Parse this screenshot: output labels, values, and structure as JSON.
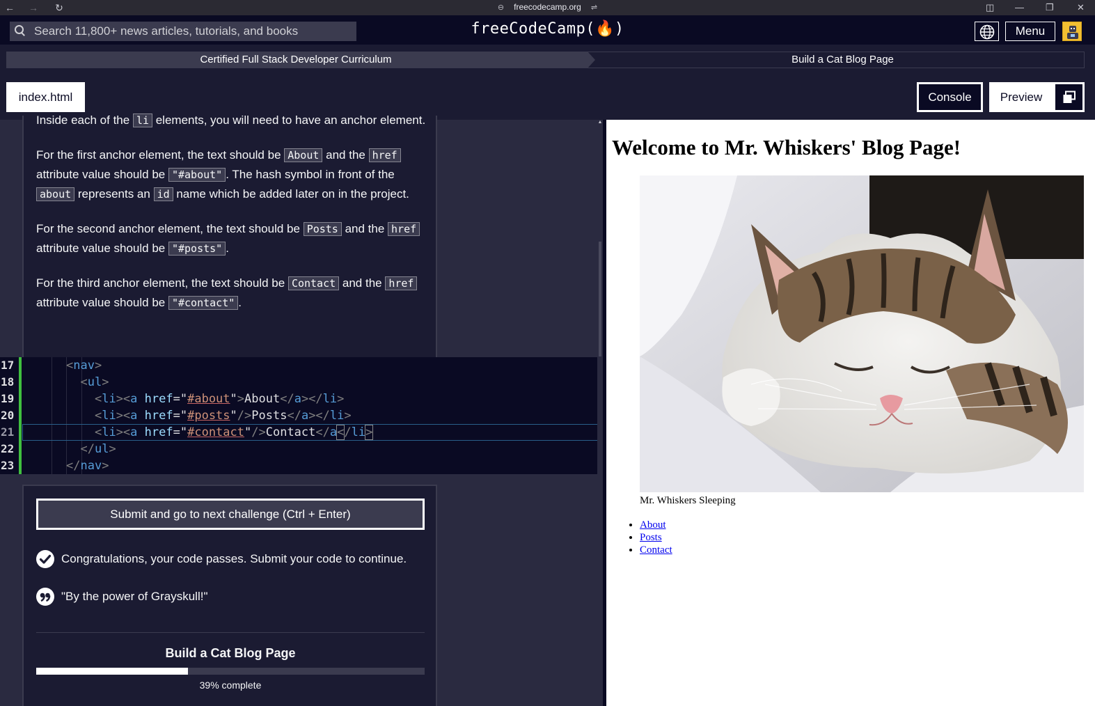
{
  "browser": {
    "url": "freecodecamp.org"
  },
  "nav": {
    "search_placeholder": "Search 11,800+ news articles, tutorials, and books",
    "logo": "freeCodeCamp(🔥)",
    "menu_label": "Menu"
  },
  "breadcrumb": {
    "curriculum": "Certified Full Stack Developer Curriculum",
    "project": "Build a Cat Blog Page"
  },
  "toolbar": {
    "file_tab": "index.html",
    "console_label": "Console",
    "preview_label": "Preview"
  },
  "instructions": {
    "p1": {
      "t1": "Inside each of the ",
      "c1": "li",
      "t2": " elements, you will need to have an anchor element."
    },
    "p2": {
      "t1": "For the first anchor element, the text should be ",
      "c1": "About",
      "t2": " and the ",
      "c2": "href",
      "t3": " attribute value should be ",
      "c3": "\"#about\"",
      "t4": ". The hash symbol in front of the ",
      "c4": "about",
      "t5": " represents an ",
      "c5": "id",
      "t6": " name which be added later on in the project."
    },
    "p3": {
      "t1": "For the second anchor element, the text should be ",
      "c1": "Posts",
      "t2": " and the ",
      "c2": "href",
      "t3": " attribute value should be ",
      "c3": "\"#posts\"",
      "t4": "."
    },
    "p4": {
      "t1": "For the third anchor element, the text should be ",
      "c1": "Contact",
      "t2": " and the ",
      "c2": "href",
      "t3": " attribute value should be ",
      "c3": "\"#contact\"",
      "t4": "."
    }
  },
  "editor": {
    "line_numbers": [
      "17",
      "18",
      "19",
      "20",
      "21",
      "22",
      "23"
    ],
    "lines": [
      {
        "indent": "",
        "parts": [
          [
            "brk",
            "<"
          ],
          [
            "tag",
            "nav"
          ],
          [
            "brk",
            ">"
          ]
        ]
      },
      {
        "indent": "  ",
        "parts": [
          [
            "brk",
            "<"
          ],
          [
            "tag",
            "ul"
          ],
          [
            "brk",
            ">"
          ]
        ]
      },
      {
        "indent": "    ",
        "parts": [
          [
            "brk",
            "<"
          ],
          [
            "tag",
            "li"
          ],
          [
            "brk",
            "><"
          ],
          [
            "tag",
            "a"
          ],
          [
            "txt",
            " "
          ],
          [
            "attr",
            "href"
          ],
          [
            "txt",
            "=\""
          ],
          [
            "str",
            "#about"
          ],
          [
            "txt",
            "\""
          ],
          [
            "brk",
            ">"
          ],
          [
            "txt",
            "About"
          ],
          [
            "brk",
            "</"
          ],
          [
            "tag",
            "a"
          ],
          [
            "brk",
            "></"
          ],
          [
            "tag",
            "li"
          ],
          [
            "brk",
            ">"
          ]
        ]
      },
      {
        "indent": "    ",
        "parts": [
          [
            "brk",
            "<"
          ],
          [
            "tag",
            "li"
          ],
          [
            "brk",
            "><"
          ],
          [
            "tag",
            "a"
          ],
          [
            "txt",
            " "
          ],
          [
            "attr",
            "href"
          ],
          [
            "txt",
            "=\""
          ],
          [
            "str",
            "#posts"
          ],
          [
            "txt",
            "\""
          ],
          [
            "brk",
            "/>"
          ],
          [
            "txt",
            "Posts"
          ],
          [
            "brk",
            "</"
          ],
          [
            "tag",
            "a"
          ],
          [
            "brk",
            "></"
          ],
          [
            "tag",
            "li"
          ],
          [
            "brk",
            ">"
          ]
        ]
      },
      {
        "indent": "    ",
        "parts": [
          [
            "brk",
            "<"
          ],
          [
            "tag",
            "li"
          ],
          [
            "brk",
            "><"
          ],
          [
            "tag",
            "a"
          ],
          [
            "txt",
            " "
          ],
          [
            "attr",
            "href"
          ],
          [
            "txt",
            "=\""
          ],
          [
            "str",
            "#contact"
          ],
          [
            "txt",
            "\""
          ],
          [
            "brk",
            "/>"
          ],
          [
            "txt",
            "Contact"
          ],
          [
            "brk",
            "</"
          ],
          [
            "tag",
            "a"
          ],
          [
            "brkbox",
            "<"
          ],
          [
            "brk",
            "/"
          ],
          [
            "tag",
            "li"
          ],
          [
            "brkbox",
            ">"
          ]
        ]
      },
      {
        "indent": "  ",
        "parts": [
          [
            "brk",
            "</"
          ],
          [
            "tag",
            "ul"
          ],
          [
            "brk",
            ">"
          ]
        ]
      },
      {
        "indent": "",
        "parts": [
          [
            "brk",
            "</"
          ],
          [
            "tag",
            "nav"
          ],
          [
            "brk",
            ">"
          ]
        ]
      }
    ]
  },
  "lower": {
    "submit_label": "Submit and go to next challenge (Ctrl + Enter)",
    "pass_message": "Congratulations, your code passes. Submit your code to continue.",
    "quote": "\"By the power of Grayskull!\"",
    "progress_title": "Build a Cat Blog Page",
    "progress_value": 39,
    "progress_label": "39% complete"
  },
  "preview_page": {
    "heading": "Welcome to Mr. Whiskers' Blog Page!",
    "caption": "Mr. Whiskers Sleeping",
    "links": [
      "About",
      "Posts",
      "Contact"
    ]
  },
  "colors": {
    "bg": "#0a0a23",
    "panel": "#1b1b32",
    "gray": "#3b3b4f",
    "diff_green": "#3fbf3f",
    "avatar_yellow": "#f1be32"
  }
}
